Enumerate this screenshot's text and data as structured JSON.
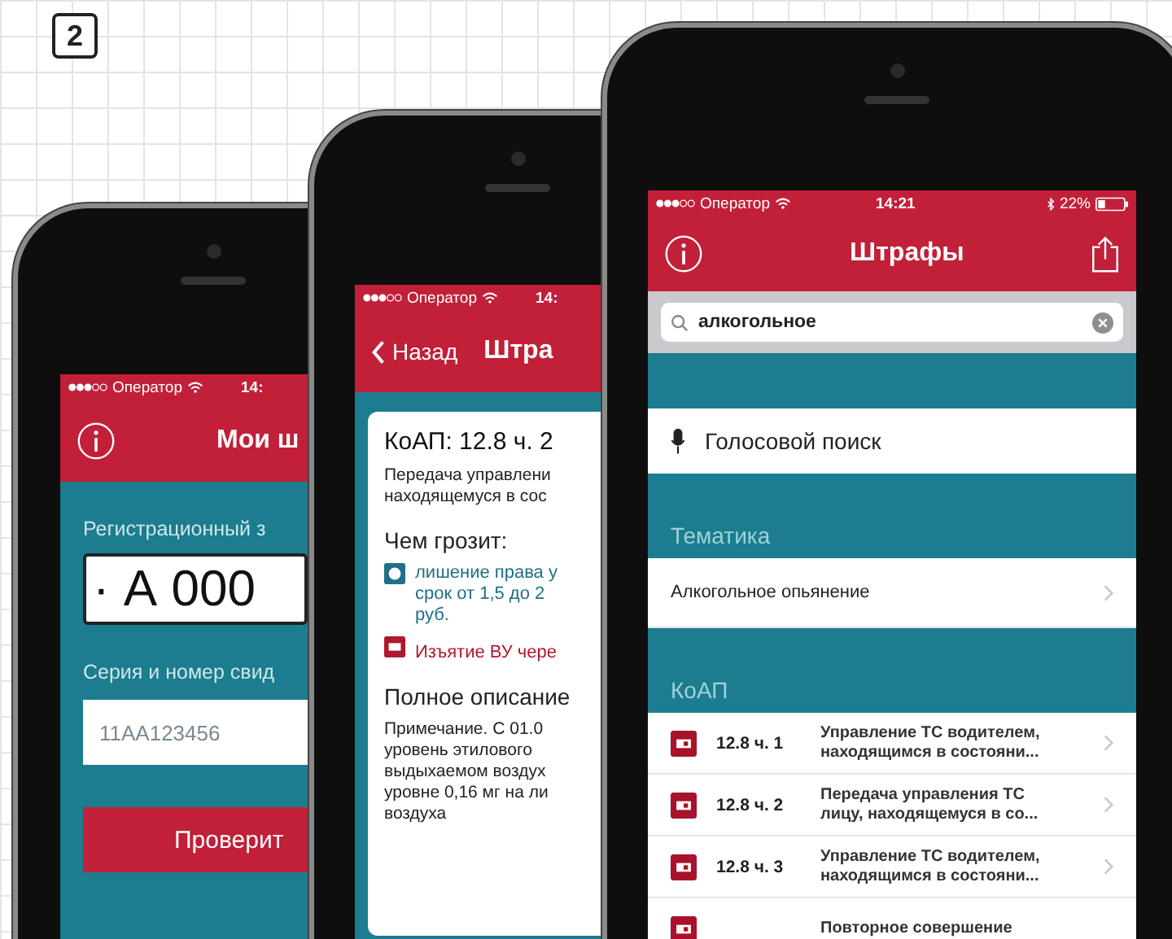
{
  "badge": "2",
  "phones": [
    {
      "kind": "plate_form",
      "status": {
        "carrier": "Оператор",
        "time": "14:"
      },
      "header": {
        "title": "Мои ш"
      },
      "fields": [
        {
          "kind": "plate",
          "label": "Регистрационный з",
          "value": "· А 000"
        },
        {
          "kind": "text",
          "label": "Серия и номер свид",
          "placeholder": "11AA123456"
        }
      ],
      "button": "Проверит"
    },
    {
      "kind": "detail",
      "status": {
        "carrier": "Оператор",
        "time": "14:"
      },
      "header": {
        "back": "Назад",
        "title": "Штра"
      },
      "card": {
        "title": "КоАП: 12.8 ч. 2",
        "summary": [
          "Передача управлени",
          "находящемуся в сос"
        ],
        "threats_heading": "Чем грозит:",
        "threats": [
          {
            "kind": "license",
            "color": "#1f6f86",
            "lines": [
              "лишение права у",
              "срок от 1,5 до 2",
              "руб."
            ]
          },
          {
            "kind": "seizure",
            "color": "#b0182e",
            "lines": [
              "Изъятие ВУ чере"
            ]
          }
        ],
        "full_heading": "Полное описание",
        "full_text": [
          "Примечание. С 01.0",
          "уровень этилового",
          "выдыхаемом воздух",
          "уровне 0,16 мг на ли",
          "воздуха"
        ]
      }
    },
    {
      "kind": "search",
      "status": {
        "carrier": "Оператор",
        "time": "14:21",
        "battery": "22%"
      },
      "header": {
        "title": "Штрафы"
      },
      "search": {
        "value": "алкогольное"
      },
      "voice": "Голосовой поиск",
      "sections": [
        {
          "heading": "Тематика",
          "rows": [
            {
              "title": "Алкогольное опьянение"
            }
          ]
        },
        {
          "heading": "КоАП",
          "rows": [
            {
              "code": "12.8 ч. 1",
              "lines": [
                "Управление ТС водителем,",
                "находящимся в состояни..."
              ]
            },
            {
              "code": "12.8 ч. 2",
              "lines": [
                "Передача управления ТС",
                "лицу, находящемуся в со..."
              ]
            },
            {
              "code": "12.8 ч. 3",
              "lines": [
                "Управление ТС водителем,",
                "находящимся в состояни..."
              ]
            },
            {
              "lines": [
                "Повторное совершение"
              ]
            }
          ]
        }
      ]
    }
  ]
}
